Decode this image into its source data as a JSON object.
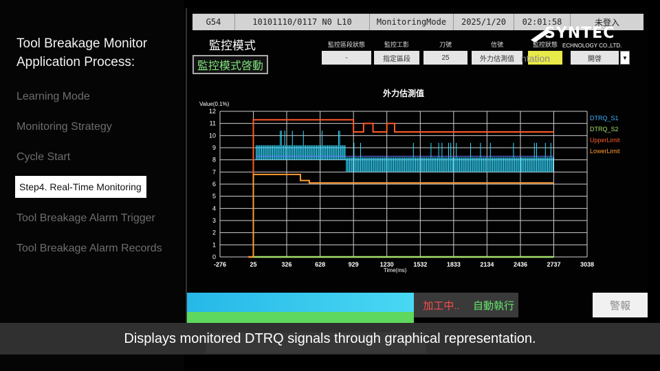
{
  "sidebar": {
    "title": "Tool Breakage Monitor Application Process:",
    "steps": [
      {
        "label": "Learning Mode"
      },
      {
        "label": "Monitoring Strategy"
      },
      {
        "label": "Cycle Start"
      },
      {
        "label": "Step4.  Real-Time Monitoring"
      },
      {
        "label": "Tool Breakage Alarm Trigger"
      },
      {
        "label": "Tool Breakage Alarm Records"
      }
    ]
  },
  "screen": {
    "status_bar": {
      "gcode": "G54",
      "program": "10101110/0117 N0 L10",
      "mode": "MonitoringMode",
      "date": "2025/1/20",
      "time": "02:01:58",
      "login": "未登入"
    },
    "logo": {
      "name": "SYNTEC",
      "sub": "ECHNOLOGY CO.,LTD."
    },
    "mode_title": "監控模式",
    "mode_start": "監控模式啓動",
    "fields": {
      "headers": [
        "監控區段狀態",
        "監控工影",
        "刀號",
        "信號",
        "監控狀態"
      ],
      "values": [
        "-",
        "指定區段",
        "25",
        "外力估測值",
        ""
      ],
      "enable": "開啓",
      "dropdown_icon": "▼"
    },
    "bleed_text": "ntation",
    "bottom": {
      "processing": "加工中..",
      "auto": "自動執行",
      "alarm": "警報"
    }
  },
  "colors": {
    "dtrq_s1": "#3fb3ff",
    "dtrq_s2": "#a5e06a",
    "upper_limit": "#ff5a2a",
    "lower_limit": "#ff9a30",
    "signal_cyan": "#32d9ff"
  },
  "chart_data": {
    "type": "line",
    "title": "外力估測值",
    "ylabel": "Value(0.1%)",
    "xlabel": "Time(ms)",
    "ylim": [
      0,
      12
    ],
    "yticks": [
      0,
      1,
      2,
      3,
      4,
      5,
      6,
      7,
      8,
      9,
      10,
      11,
      12
    ],
    "xticks": [
      -276,
      25,
      326,
      628,
      929,
      1230,
      1532,
      1833,
      2134,
      2436,
      2737,
      3038
    ],
    "xlim": [
      -276,
      3038
    ],
    "grid": true,
    "legend": "right",
    "series": [
      {
        "name": "DTRQ_S1",
        "x": [
          25,
          2737
        ],
        "y": [
          7.6,
          7.6
        ]
      },
      {
        "name": "DTRQ_S2",
        "x": [
          25,
          2737
        ],
        "y": [
          0,
          0
        ]
      },
      {
        "name": "UpperLimit",
        "x": [
          25,
          25,
          929,
          929,
          1020,
          1020,
          1105,
          1105,
          1230,
          1230,
          1300,
          1300,
          2737
        ],
        "y": [
          0,
          11.3,
          11.3,
          10.3,
          10.3,
          11,
          11,
          10.3,
          10.3,
          11,
          11,
          10.3,
          10.3
        ]
      },
      {
        "name": "LowerLimit",
        "x": [
          25,
          25,
          450,
          450,
          530,
          530,
          2737
        ],
        "y": [
          0,
          6.8,
          6.8,
          6.3,
          6.3,
          6.1,
          6.1
        ]
      }
    ]
  },
  "caption": "Displays monitored DTRQ signals through graphical representation."
}
